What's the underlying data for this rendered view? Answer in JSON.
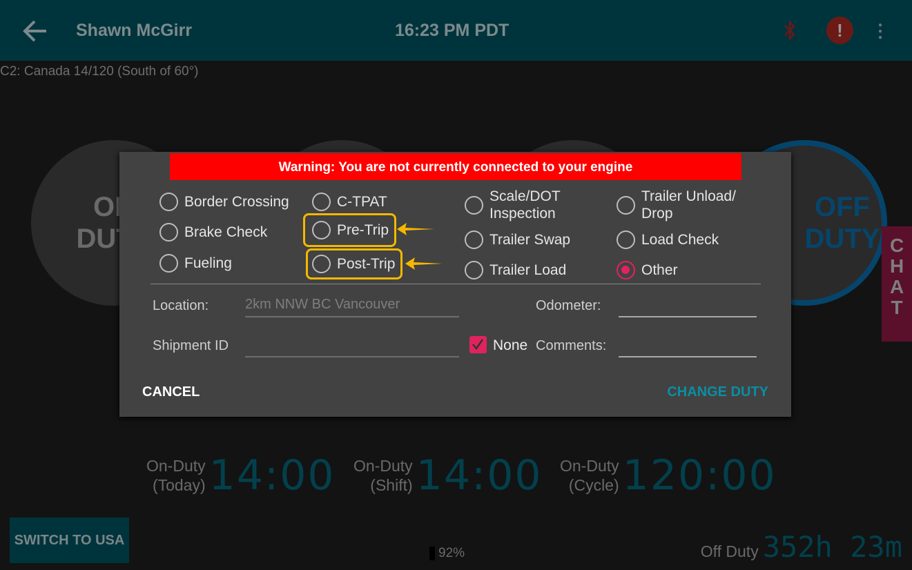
{
  "header": {
    "driver_name": "Shawn McGirr",
    "time": "16:23 PM PDT",
    "back_icon": "arrow-left-icon",
    "bluetooth_icon": "bluetooth-disabled-icon",
    "alert_icon": "alert-icon",
    "menu_icon": "more-vertical-icon"
  },
  "ruleset": "C2: Canada 14/120 (South of 60°)",
  "duty_circles": [
    {
      "label": "ON DUTY"
    },
    {
      "label": ""
    },
    {
      "label": ""
    },
    {
      "label": "OFF DUTY"
    }
  ],
  "chat_tab": "CHAT",
  "timers": [
    {
      "label1": "On-Duty",
      "label2": "(Today)",
      "value": "14:00"
    },
    {
      "label1": "On-Duty",
      "label2": "(Shift)",
      "value": "14:00"
    },
    {
      "label1": "On-Duty",
      "label2": "(Cycle)",
      "value": "120:00"
    }
  ],
  "switch_button": "SWITCH TO USA",
  "battery": "92%",
  "off_duty": {
    "label": "Off Duty",
    "value": "352h 23m"
  },
  "dialog": {
    "warning": "Warning: You are not currently connected to your engine",
    "options": [
      {
        "label": "Border Crossing",
        "selected": false
      },
      {
        "label": "Brake Check",
        "selected": false
      },
      {
        "label": "Fueling",
        "selected": false
      },
      {
        "label": "C-TPAT",
        "selected": false
      },
      {
        "label": "Pre-Trip",
        "selected": false,
        "highlighted": true
      },
      {
        "label": "Post-Trip",
        "selected": false,
        "highlighted": true
      },
      {
        "label": "Scale/DOT Inspection",
        "selected": false
      },
      {
        "label": "Trailer Swap",
        "selected": false
      },
      {
        "label": "Trailer Load",
        "selected": false
      },
      {
        "label": "Trailer Unload/ Drop",
        "selected": false
      },
      {
        "label": "Load Check",
        "selected": false
      },
      {
        "label": "Other",
        "selected": true
      }
    ],
    "location_label": "Location:",
    "location_placeholder": "2km NNW BC Vancouver",
    "odometer_label": "Odometer:",
    "odometer_value": "",
    "shipment_label": "Shipment ID",
    "shipment_value": "",
    "none_label": "None",
    "none_checked": true,
    "comments_label": "Comments:",
    "comments_value": "",
    "cancel": "CANCEL",
    "change_duty": "CHANGE DUTY",
    "accent": "#e0235f",
    "highlight_color": "#f5b800"
  }
}
